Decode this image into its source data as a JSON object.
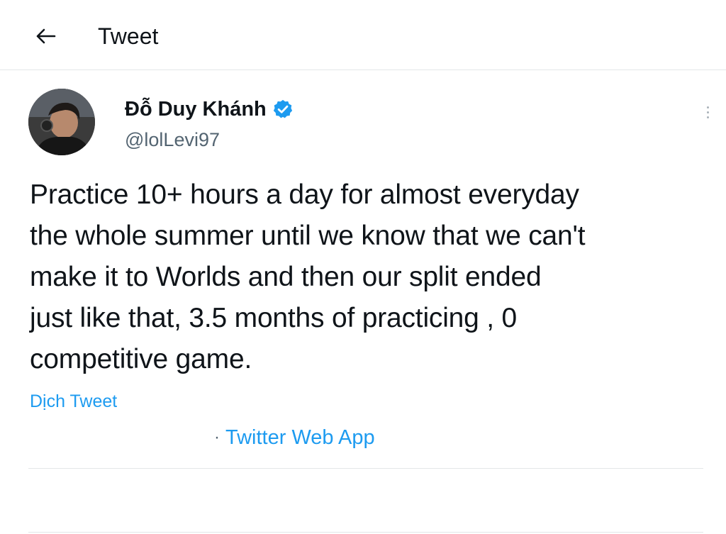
{
  "header": {
    "title": "Tweet",
    "back_icon": "arrow-left-icon"
  },
  "author": {
    "display_name": "Đỗ Duy Khánh",
    "handle": "@lolLevi97",
    "verified": true,
    "verified_icon": "verified-badge-icon",
    "avatar_icon": "user-avatar"
  },
  "tweet": {
    "text": "Practice 10+ hours a day for almost everyday\nthe whole summer until we know that we can't\nmake it to Worlds and then our split ended\njust like that, 3.5 months of practicing , 0\ncompetitive game.",
    "translate_label": "Dịch Tweet",
    "meta_separator": "·",
    "source_label": "Twitter Web App"
  },
  "menu": {
    "more_icon": "more-vertical-icon"
  },
  "colors": {
    "accent": "#1d9bf0",
    "text_primary": "#0f1419",
    "text_secondary": "#536471",
    "divider": "#e3e6e8"
  }
}
